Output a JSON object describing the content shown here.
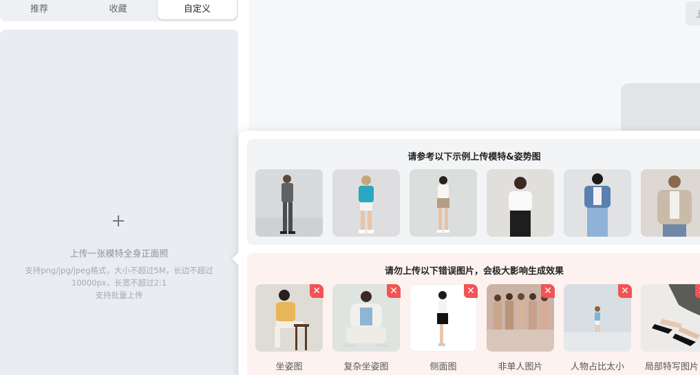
{
  "tabs": [
    {
      "label": "推荐",
      "active": false
    },
    {
      "label": "收藏",
      "active": false
    },
    {
      "label": "自定义",
      "active": true
    }
  ],
  "upload": {
    "title": "上传一张模特全身正面照",
    "desc_line1": "支持png/jpg/jpeg格式，大小不超过5M，长边不超过",
    "desc_line2": "10000px，长宽不超过2:1",
    "desc_line3": "支持批量上传"
  },
  "top_button_partial": "上",
  "good_examples": {
    "title": "请参考以下示例上传模特&姿势图",
    "count": 6
  },
  "bad_examples": {
    "title": "请勿上传以下错误图片，会极大影响生成效果",
    "items": [
      "坐姿图",
      "复杂坐姿图",
      "侧面图",
      "非单人图片",
      "人物占比太小",
      "局部特写图片"
    ]
  },
  "colors": {
    "accent_red": "#f05454",
    "panel_grey": "#e9ecf0",
    "bad_bg": "#fdf2f0",
    "good_bg": "#f3f4f6"
  },
  "icons": {
    "add": "plus-icon",
    "remove": "close-icon"
  }
}
